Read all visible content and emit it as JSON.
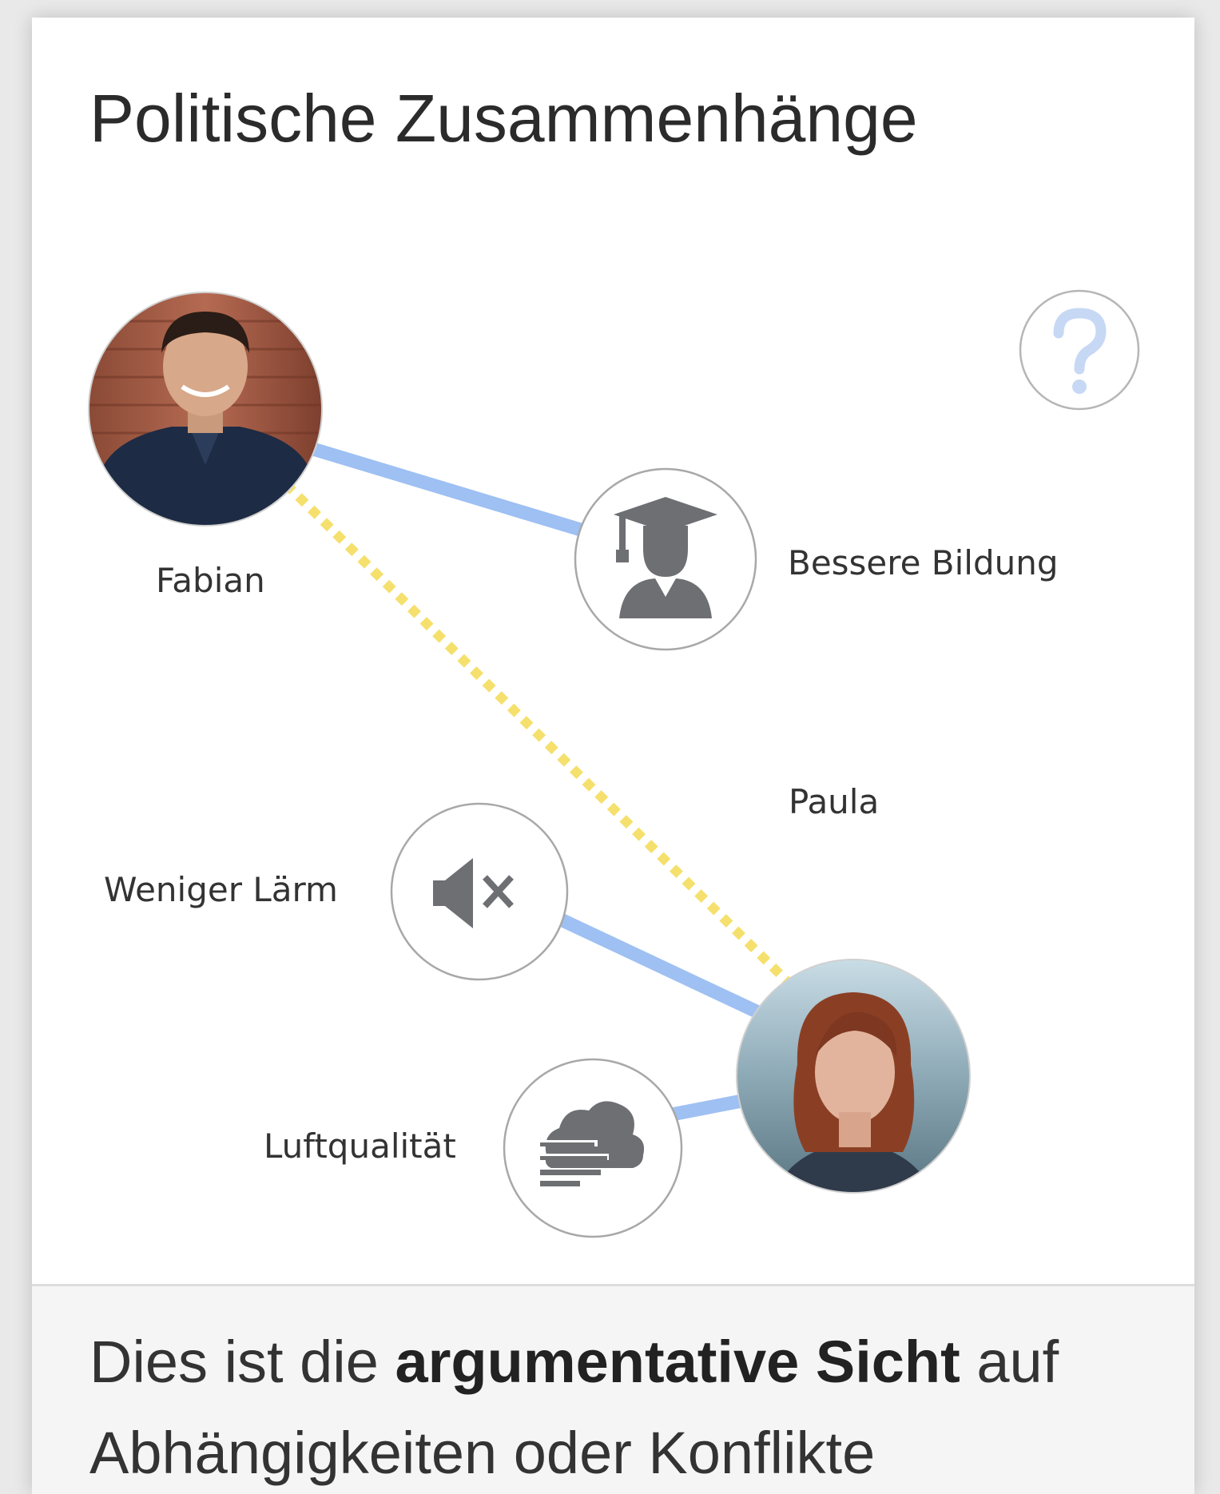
{
  "card": {
    "title": "Politische Zusammenhänge"
  },
  "graph": {
    "nodes": {
      "fabian": {
        "label": "Fabian",
        "kind": "person-avatar"
      },
      "paula": {
        "label": "Paula",
        "kind": "person-avatar"
      },
      "bildung": {
        "label": "Bessere Bildung",
        "icon": "graduation-student-icon"
      },
      "laerm": {
        "label": "Weniger Lärm",
        "icon": "speaker-mute-icon"
      },
      "luft": {
        "label": "Luftqualität",
        "icon": "fog-cloud-icon"
      }
    },
    "help": {
      "icon": "question-mark-icon"
    },
    "colors": {
      "support_edge": "#9ec0f2",
      "conflict_edge": "#f5e06e",
      "icon_fill": "#6d6f73",
      "help_icon": "#c7d8f5",
      "node_border": "#a8a8a8"
    }
  },
  "footer": {
    "text_before": "Dies ist die ",
    "text_bold": "argumentative Sicht",
    "text_after": " auf Abhängigkeiten oder Konflikte"
  }
}
